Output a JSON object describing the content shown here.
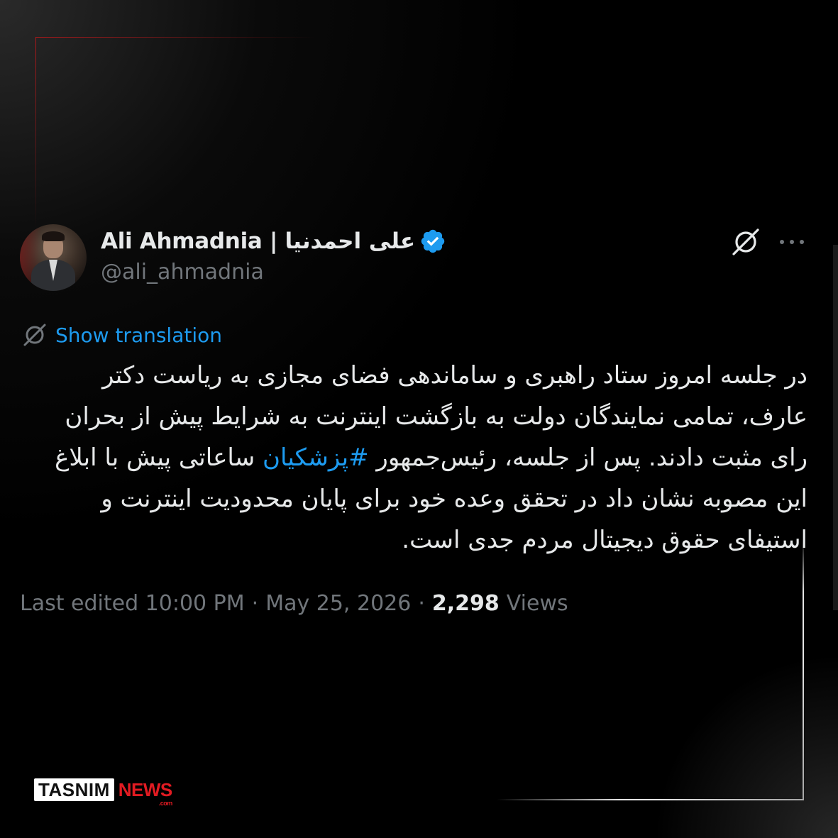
{
  "tweet": {
    "author": {
      "display_name": "Ali Ahmadnia | علی احمدنیا",
      "handle": "@ali_ahmadnia",
      "verified": true
    },
    "header_icons": [
      "grok-icon",
      "more-icon"
    ],
    "translate": {
      "icon": "globe-translate-icon",
      "label": "Show translation"
    },
    "body": {
      "segments": [
        "در جلسه امروز ستاد راهبری و ساماندهی فضای مجازی به ریاست دکتر عارف، تمامی نمایندگان دولت به بازگشت اینترنت به شرایط پیش از بحران رای مثبت دادند. پس از جلسه، رئیس‌جمهور ",
        "#پزشکیان",
        " ساعاتی پیش با ابلاغ این مصوبه نشان داد در تحقق وعده خود برای پایان محدودیت اینترنت و استیفای حقوق دیجیتال مردم جدی است."
      ],
      "hashtag_color": "#1d9bf0"
    },
    "meta": {
      "last_edited": "Last edited 10:00 PM",
      "separator": "·",
      "date": "May 25, 2026",
      "views_count": "2,298",
      "views_label": "Views"
    }
  },
  "watermark": {
    "brand": "TASNIM",
    "news": "NEWS",
    "suffix": ".com",
    "accent_color": "#e21b22"
  },
  "colors": {
    "background": "#000000",
    "text_primary": "#e7e9ea",
    "text_secondary": "#71767b",
    "link": "#1d9bf0",
    "verified": "#1d9bf0",
    "frame_red": "#b0181a",
    "frame_white": "#e6e6e6"
  }
}
